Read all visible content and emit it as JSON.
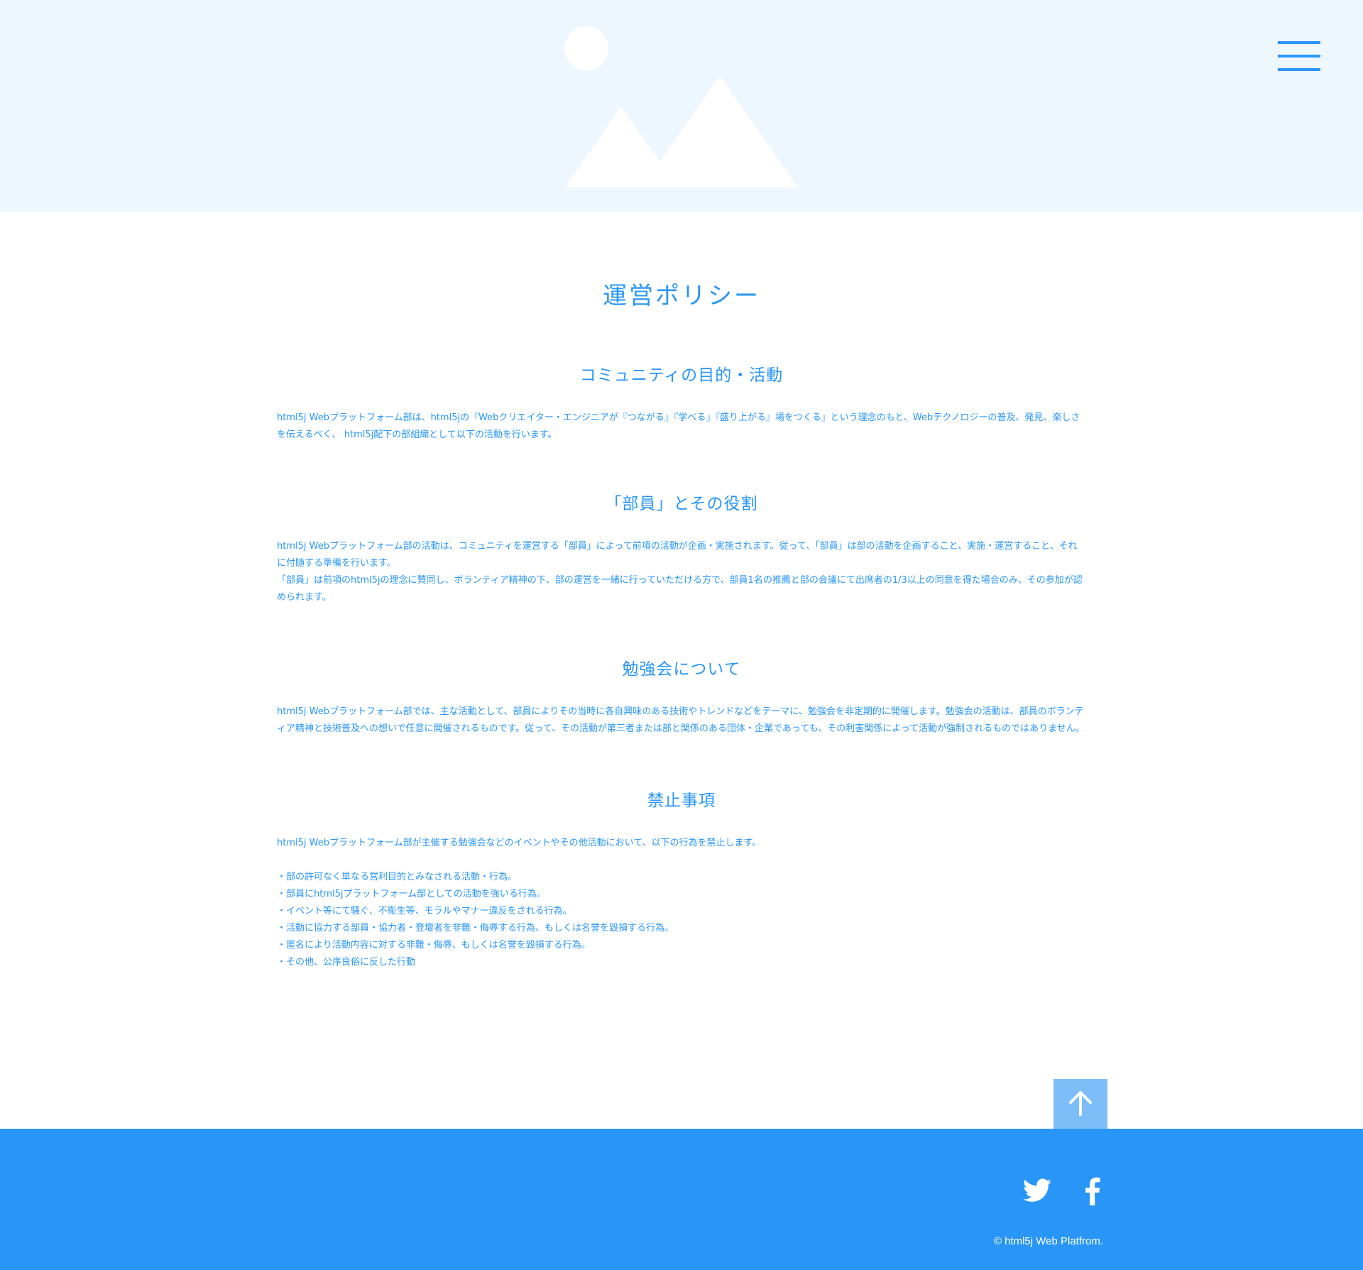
{
  "header": {
    "hero_image_icon": "image-placeholder-icon",
    "menu_icon": "hamburger-menu-icon"
  },
  "main": {
    "title": "運営ポリシー",
    "sections": [
      {
        "heading": "コミュニティの目的・活動",
        "paragraphs": [
          "html5j Webプラットフォーム部は、html5jの『Webクリエイター・エンジニアが『つながる』『学べる』『盛り上がる』場をつくる』という理念のもと、Webテクノロジーの普及、発見、楽しさを伝えるべく、 html5j配下の部組織として以下の活動を行います。"
        ]
      },
      {
        "heading": "「部員」とその役割",
        "paragraphs": [
          "html5j Webプラットフォーム部の活動は、コミュニティを運営する「部員」によって前項の活動が企画・実施されます。従って、「部員」は部の活動を企画すること、実施・運営すること、それに付随する準備を行います。",
          "「部員」は前項のhtml5jの理念に賛同し、ボランティア精神の下、部の運営を一緒に行っていただける方で、部員1名の推薦と部の会議にて出席者の1/3以上の同意を得た場合のみ、その参加が認められます。"
        ]
      },
      {
        "heading": "勉強会について",
        "paragraphs": [
          "html5j Webプラットフォーム部では、主な活動として、部員によりその当時に各自興味のある技術やトレンドなどをテーマに、勉強会を非定期的に開催します。勉強会の活動は、部員のボランティア精神と技術普及への想いで任意に開催されるものです。従って、その活動が第三者または部と関係のある団体・企業であっても、その利害関係によって活動が強制されるものではありません。"
        ]
      },
      {
        "heading": "禁止事項",
        "intro": "html5j Webプラットフォーム部が主催する勉強会などのイベントやその他活動において、以下の行為を禁止します。",
        "items": [
          "・部の許可なく単なる営利目的とみなされる活動・行為。",
          "・部員にhtml5jプラットフォーム部としての活動を強いる行為。",
          "・イベント等にて騒ぐ、不衛生等、モラルやマナー違反をされる行為。",
          "・活動に協力する部員・協力者・登壇者を非難・侮辱する行為、もしくは名誉を毀損する行為。",
          "・匿名により活動内容に対する非難・侮辱、もしくは名誉を毀損する行為。",
          "・その他、公序良俗に反した行動"
        ]
      }
    ]
  },
  "back_to_top": {
    "icon": "arrow-up-icon"
  },
  "footer": {
    "social": [
      "twitter-icon",
      "facebook-icon"
    ],
    "copyright": "© html5j Web Platfrom."
  },
  "colors": {
    "accent": "#2996f7",
    "hero_bg": "#eff7fe",
    "back_to_top_bg": "#7dbdf8",
    "footer_bg": "#2996f7"
  }
}
